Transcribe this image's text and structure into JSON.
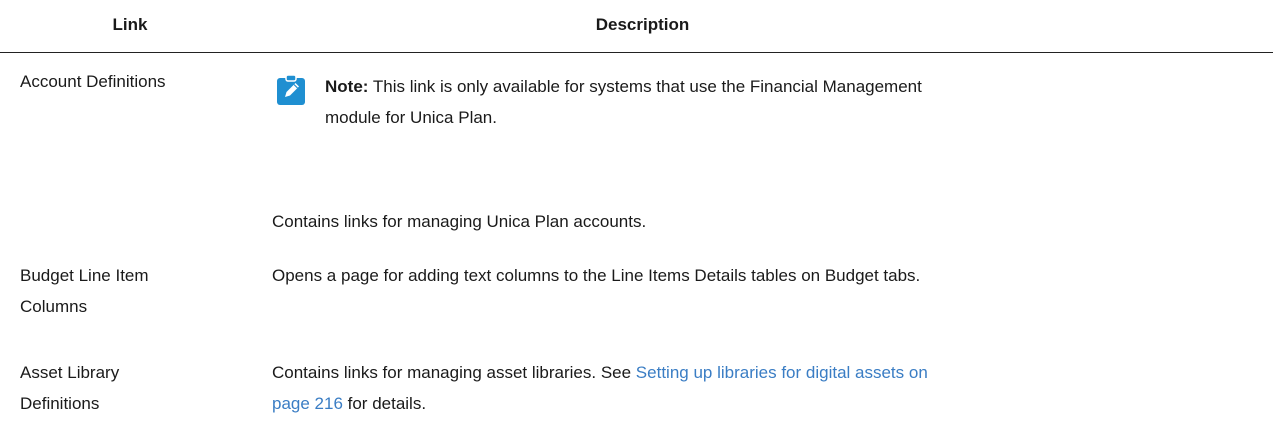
{
  "table": {
    "headers": {
      "link": "Link",
      "description": "Description"
    },
    "rows": [
      {
        "link": "Account Definitions",
        "note": {
          "icon": "note-pencil-icon",
          "label": "Note:",
          "text_line1": "This link is only available for systems that use the Financial Management",
          "text_line2": "module for Unica Plan."
        },
        "description": "Contains links for managing Unica Plan accounts."
      },
      {
        "link_line1": "Budget Line Item",
        "link_line2": "Columns",
        "description": "Opens a page for adding text columns to the Line Items Details tables on Budget tabs."
      },
      {
        "link_line1": "Asset Library",
        "link_line2": "Definitions",
        "description_before": "Contains links for managing asset libraries. See ",
        "xref_line1": "Setting up libraries for digital assets on",
        "xref_line2": "page 216",
        "description_after": " for details."
      }
    ]
  },
  "colors": {
    "note_icon": "#1f8fd1",
    "link": "#3a7dc4",
    "rule": "#222222"
  }
}
